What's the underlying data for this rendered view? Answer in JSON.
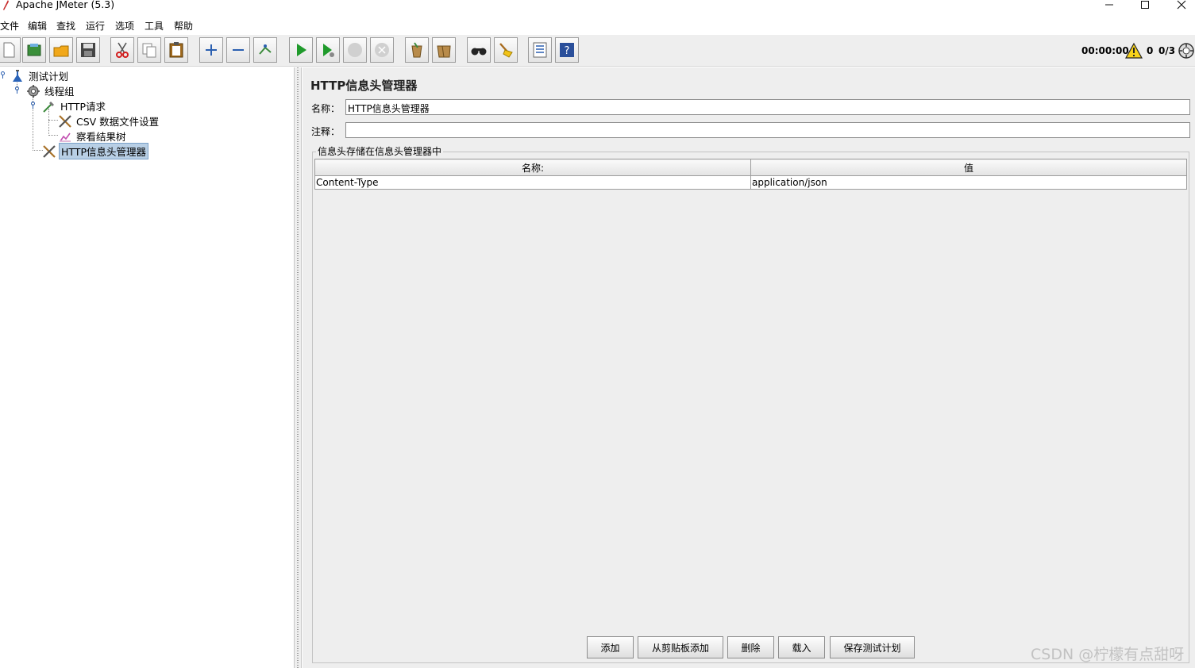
{
  "window": {
    "title": "Apache JMeter (5.3)",
    "controls": [
      "minimize-icon",
      "maximize-icon",
      "close-icon"
    ]
  },
  "menu": {
    "items": [
      "文件",
      "编辑",
      "查找",
      "运行",
      "选项",
      "工具",
      "帮助"
    ]
  },
  "toolbar": {
    "buttons": [
      "new-icon",
      "templates-icon",
      "open-icon",
      "save-icon",
      "cut-icon",
      "copy-icon",
      "paste-icon",
      "expand-icon",
      "collapse-icon",
      "toggle-icon",
      "start-icon",
      "start-no-pause-icon",
      "stop-icon",
      "shutdown-icon",
      "clear-icon",
      "clear-all-icon",
      "search-icon",
      "reset-search-icon",
      "function-helper-icon",
      "help-icon"
    ],
    "elapsed_time": "00:00:00",
    "error_count": "0",
    "active_threads": "0/3"
  },
  "tree": {
    "items": [
      {
        "label": "测试计划",
        "icon": "test-plan-icon",
        "level": 0
      },
      {
        "label": "线程组",
        "icon": "thread-group-icon",
        "level": 1
      },
      {
        "label": "HTTP请求",
        "icon": "sampler-icon",
        "level": 2
      },
      {
        "label": "CSV 数据文件设置",
        "icon": "config-element-icon",
        "level": 3
      },
      {
        "label": "察看结果树",
        "icon": "listener-icon",
        "level": 3
      },
      {
        "label": "HTTP信息头管理器",
        "icon": "config-element-icon",
        "level": 2,
        "selected": true
      }
    ]
  },
  "editor": {
    "title": "HTTP信息头管理器",
    "name_label": "名称：",
    "name_value": "HTTP信息头管理器",
    "comment_label": "注释：",
    "comment_value": "",
    "group_title": "信息头存储在信息头管理器中",
    "table": {
      "columns": [
        "名称:",
        "值"
      ],
      "rows": [
        [
          "Content-Type",
          "application/json"
        ]
      ]
    },
    "buttons": {
      "add": "添加",
      "add_from_clipboard": "从剪贴板添加",
      "delete": "删除",
      "load": "载入",
      "save_test_plan": "保存测试计划"
    }
  },
  "watermark": "CSDN @柠檬有点甜呀",
  "colors": {
    "panel_bg": "#eeeeee",
    "selection_bg": "#b8cfe5",
    "run_green": "#1f9a2b"
  }
}
